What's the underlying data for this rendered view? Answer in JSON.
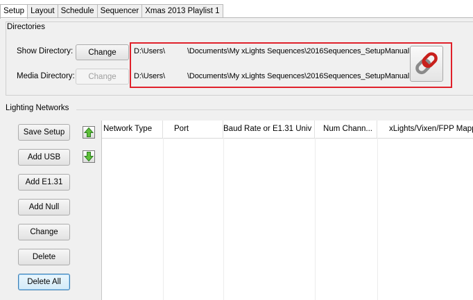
{
  "tabs": [
    "Setup",
    "Layout",
    "Schedule",
    "Sequencer",
    "Xmas 2013 Playlist 1"
  ],
  "directories": {
    "title": "Directories",
    "show": {
      "label": "Show Directory:",
      "button": "Change",
      "path_prefix": "D:\\Users\\",
      "path_suffix": "\\Documents\\My xLights Sequences\\2016Sequences_SetupManual"
    },
    "media": {
      "label": "Media Directory:",
      "button": "Change",
      "path_prefix": "D:\\Users\\",
      "path_suffix": "\\Documents\\My xLights Sequences\\2016Sequences_SetupManual"
    },
    "link_icon": "chain-link-icon",
    "highlight_color": "#e0202a"
  },
  "networks": {
    "title": "Lighting Networks",
    "buttons": [
      "Save Setup",
      "Add USB",
      "Add E1.31",
      "Add Null",
      "Change",
      "Delete",
      "Delete All"
    ],
    "move_up_icon": "arrow-up-icon",
    "move_down_icon": "arrow-down-icon",
    "columns": [
      "Network Type",
      "Port",
      "Baud Rate or E1.31 Univ",
      "Num Chann...",
      "xLights/Vixen/FPP Mapping"
    ]
  }
}
